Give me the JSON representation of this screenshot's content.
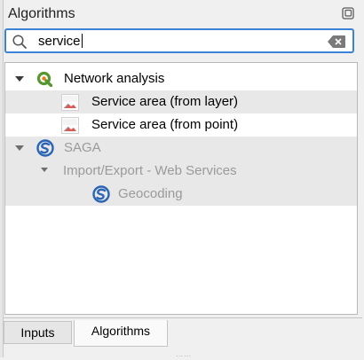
{
  "panel": {
    "title": "Algorithms",
    "float_icon": "undock-icon"
  },
  "search": {
    "value": "service",
    "icon": "search-icon",
    "clear_icon": "clear-text-icon"
  },
  "tree": {
    "items": [
      {
        "label": "Network analysis",
        "icon": "qgis-logo-icon",
        "enabled": true,
        "level": 0,
        "expanded": true
      },
      {
        "label": "Service area (from layer)",
        "icon": "algorithm-icon",
        "enabled": true,
        "level": 1,
        "selected": true
      },
      {
        "label": "Service area (from point)",
        "icon": "algorithm-icon",
        "enabled": true,
        "level": 1
      },
      {
        "label": "SAGA",
        "icon": "saga-logo-icon",
        "enabled": false,
        "level": 0,
        "expanded": true
      },
      {
        "label": "Import/Export - Web Services",
        "enabled": false,
        "level": 1,
        "expanded": true
      },
      {
        "label": "Geocoding",
        "icon": "saga-logo-icon",
        "enabled": false,
        "level": 2
      }
    ]
  },
  "tabs": [
    {
      "label": "Inputs",
      "active": false
    },
    {
      "label": "Algorithms",
      "active": true
    }
  ],
  "colors": {
    "accent": "#3c82d6",
    "qgis_green": "#589632",
    "saga_blue": "#2a64b5",
    "disabled_text": "#9a9a9a"
  }
}
